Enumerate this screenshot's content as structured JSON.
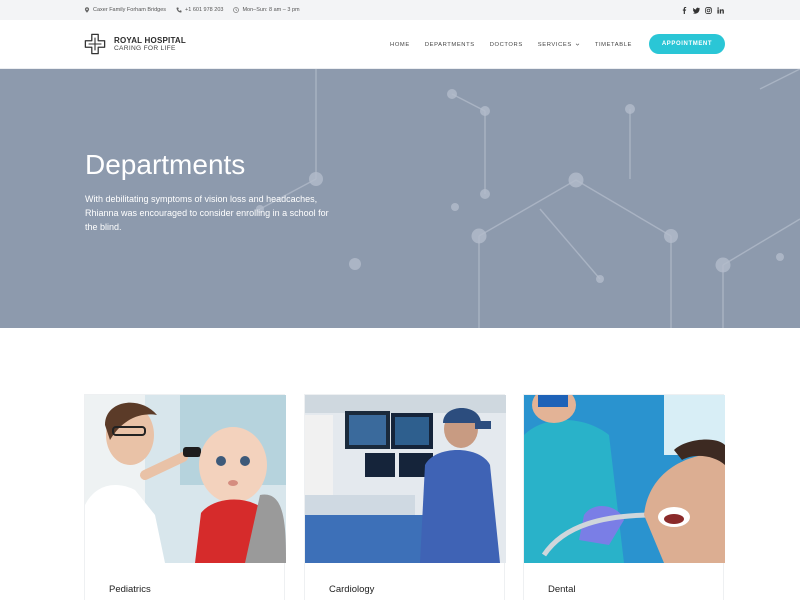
{
  "topbar": {
    "address": "Caxer Family Forham Bridges",
    "phone": "+1 601 978 203",
    "hours": "Mon–Sun: 8 am – 3 pm",
    "social": [
      "facebook-icon",
      "twitter-icon",
      "instagram-icon",
      "linkedin-icon"
    ]
  },
  "logo": {
    "name": "ROYAL HOSPITAL",
    "tagline": "CARING FOR LIFE"
  },
  "nav": {
    "items": [
      "HOME",
      "DEPARTMENTS",
      "DOCTORS",
      "SERVICES",
      "TIMETABLE"
    ],
    "cta": "APPOINTMENT"
  },
  "hero": {
    "title": "Departments",
    "text": "With debilitating symptoms of vision loss and headcaches, Rhianna was encouraged to consider enrolling in a school for the blind."
  },
  "departments": [
    {
      "label": "Pediatrics"
    },
    {
      "label": "Cardiology"
    },
    {
      "label": "Dental"
    }
  ],
  "colors": {
    "accent": "#2ac6d6",
    "hero_bg": "#8d9aad",
    "topbar_bg": "#f3f4f6"
  }
}
